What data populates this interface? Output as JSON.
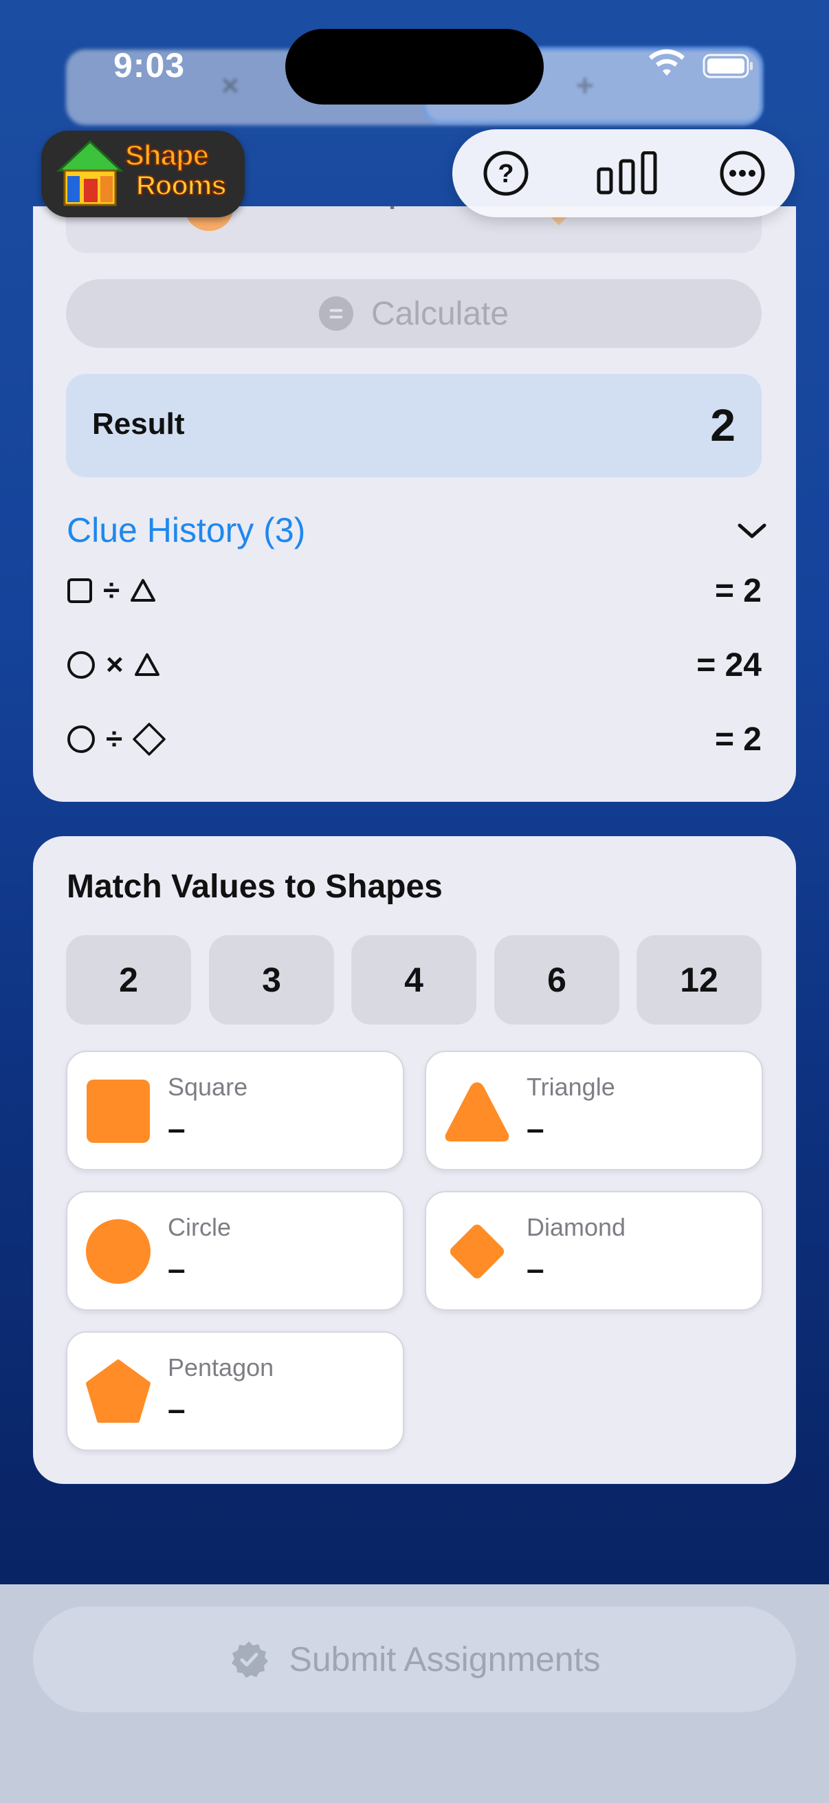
{
  "status_bar": {
    "time": "9:03"
  },
  "app": {
    "logo_line1": "Shape",
    "logo_line2": "Rooms"
  },
  "toolbar": {
    "help_icon": "question-circle-icon",
    "stats_icon": "bar-chart-icon",
    "more_icon": "ellipsis-circle-icon"
  },
  "calculator": {
    "calculate_label": "Calculate",
    "result_label": "Result",
    "result_value": "2"
  },
  "clue_history": {
    "title": "Clue History (3)",
    "clues": [
      {
        "left": "square",
        "op": "÷",
        "right": "triangle",
        "result": "= 2"
      },
      {
        "left": "circle",
        "op": "×",
        "right": "triangle",
        "result": "= 24"
      },
      {
        "left": "circle",
        "op": "÷",
        "right": "diamond",
        "result": "= 2"
      }
    ]
  },
  "match": {
    "title": "Match Values to Shapes",
    "values": [
      "2",
      "3",
      "4",
      "6",
      "12"
    ],
    "shapes": [
      {
        "name": "Square",
        "value": "–"
      },
      {
        "name": "Triangle",
        "value": "–"
      },
      {
        "name": "Circle",
        "value": "–"
      },
      {
        "name": "Diamond",
        "value": "–"
      },
      {
        "name": "Pentagon",
        "value": "–"
      }
    ]
  },
  "submit": {
    "label": "Submit Assignments"
  },
  "colors": {
    "accent": "#1e88ee",
    "shape_orange": "#ff8c26",
    "background_blue": "#15429a"
  }
}
